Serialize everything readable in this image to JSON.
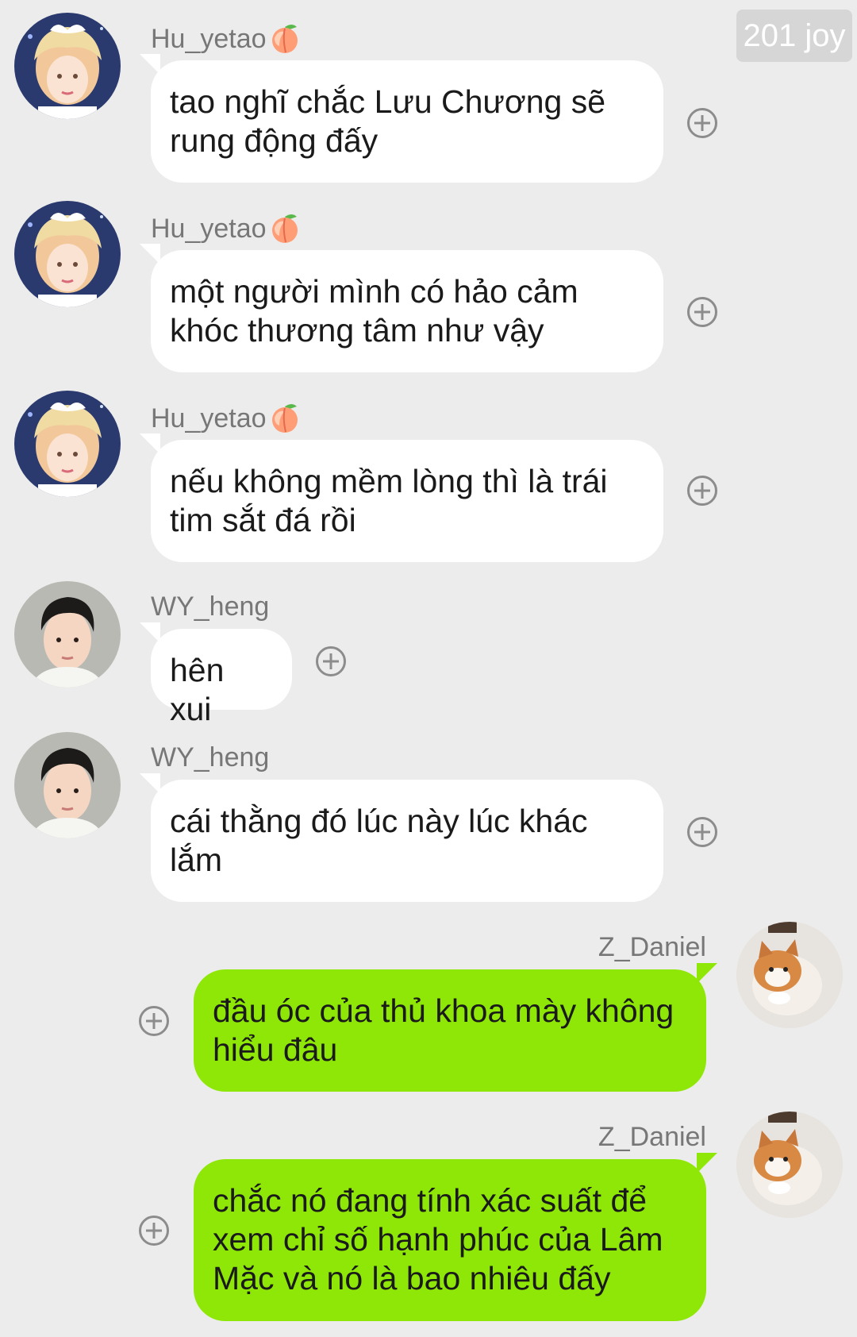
{
  "header": {
    "badge": "201 joy"
  },
  "messages": [
    {
      "sender": "Hu_yetao",
      "direction": "incoming",
      "avatar": "blonde-avatar",
      "text": "tao nghĩ chắc Lưu Chương sẽ\nrung động đấy"
    },
    {
      "sender": "Hu_yetao",
      "direction": "incoming",
      "avatar": "blonde-avatar",
      "text": "một người mình có hảo cảm\nkhóc thương tâm như vậy"
    },
    {
      "sender": "Hu_yetao",
      "direction": "incoming",
      "avatar": "blonde-avatar",
      "text": "nếu không mềm lòng thì là trái\ntim sắt đá rồi"
    },
    {
      "sender": "WY_heng",
      "direction": "incoming",
      "avatar": "dark-hair-avatar",
      "text": "hên xui"
    },
    {
      "sender": "WY_heng",
      "direction": "incoming",
      "avatar": "dark-hair-avatar",
      "text": "cái thằng đó lúc này lúc khác\nlắm"
    },
    {
      "sender": "Z_Daniel",
      "direction": "outgoing",
      "avatar": "cat-avatar",
      "text": "đầu óc của thủ khoa mày không\nhiểu đâu"
    },
    {
      "sender": "Z_Daniel",
      "direction": "outgoing",
      "avatar": "cat-avatar",
      "text": "chắc nó đang tính xác suất để\nxem chỉ số hạnh phúc của Lâm\nMặc và nó là bao nhiêu đấy"
    }
  ],
  "icons": {
    "name_badge": "peach-icon",
    "react": "add-reaction-icon"
  },
  "colors": {
    "background": "#ececec",
    "incoming_bubble": "#ffffff",
    "outgoing_bubble": "#8fe708",
    "name_text": "#777777"
  }
}
